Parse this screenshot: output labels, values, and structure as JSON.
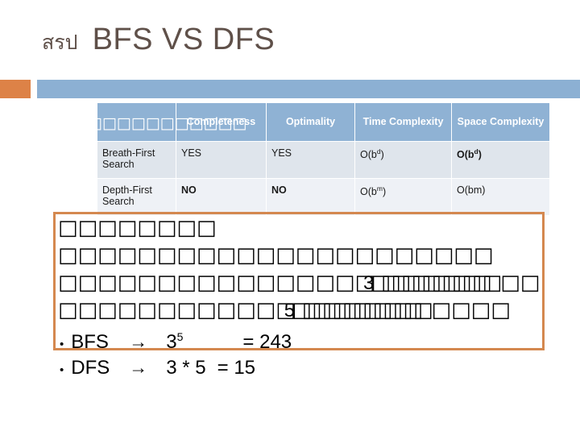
{
  "slide": {
    "title_thai": "สรป",
    "title_main": "BFS VS DFS"
  },
  "colors": {
    "accent_orange": "#dd8247",
    "accent_blue": "#8cb0d3",
    "header_blue": "#8fb2d4",
    "row_a": "#dfe5ec",
    "row_b": "#eef1f6",
    "red": "#c00000",
    "title_brown": "#5f5049",
    "box_border": "#d4884f"
  },
  "table": {
    "headers": [
      "□□□□□□□□□□□□□",
      "Completeness",
      "Optimality",
      "Time Complexity",
      "Space Complexity"
    ],
    "rows": [
      {
        "name": "Breath-First Search",
        "completeness": "YES",
        "completeness_red": false,
        "optimality": "YES",
        "optimality_red": false,
        "time_base": "O(b",
        "time_sup": "d",
        "time_tail": ")",
        "time_red": false,
        "space_base": "O(b",
        "space_sup": "d",
        "space_tail": ")",
        "space_red": true
      },
      {
        "name": "Depth-First Search",
        "completeness": "NO",
        "completeness_red": true,
        "optimality": "NO",
        "optimality_red": true,
        "time_base": "O(b",
        "time_sup": "m",
        "time_tail": ")",
        "time_red": false,
        "space_base": "O(bm)",
        "space_sup": "",
        "space_tail": "",
        "space_red": false
      }
    ]
  },
  "body": {
    "line1": "□□□□□□□□",
    "line2": "□□□□□□□□□□□□□□□□□□□□□□",
    "line3_pre": "□□□□□□□□□□□□□□□□",
    "line3_digit": "3",
    "line3_narrow": "□□□□□□□□□□□□",
    "line3_post": "□□",
    "line4_pre": "□□□□□□□□□□□□",
    "line4_digit": "5",
    "line4_narrow": "□□□□□□□□□□□□□",
    "line4_post": "□□□□"
  },
  "bullets": [
    {
      "dot": "•",
      "label": "BFS",
      "arrow": "→",
      "base": "3",
      "sup": "5",
      "result": "= 243"
    },
    {
      "dot": "•",
      "label": "DFS",
      "arrow": "→",
      "base": "3 * 5",
      "sup": "",
      "result": "= 15"
    }
  ]
}
